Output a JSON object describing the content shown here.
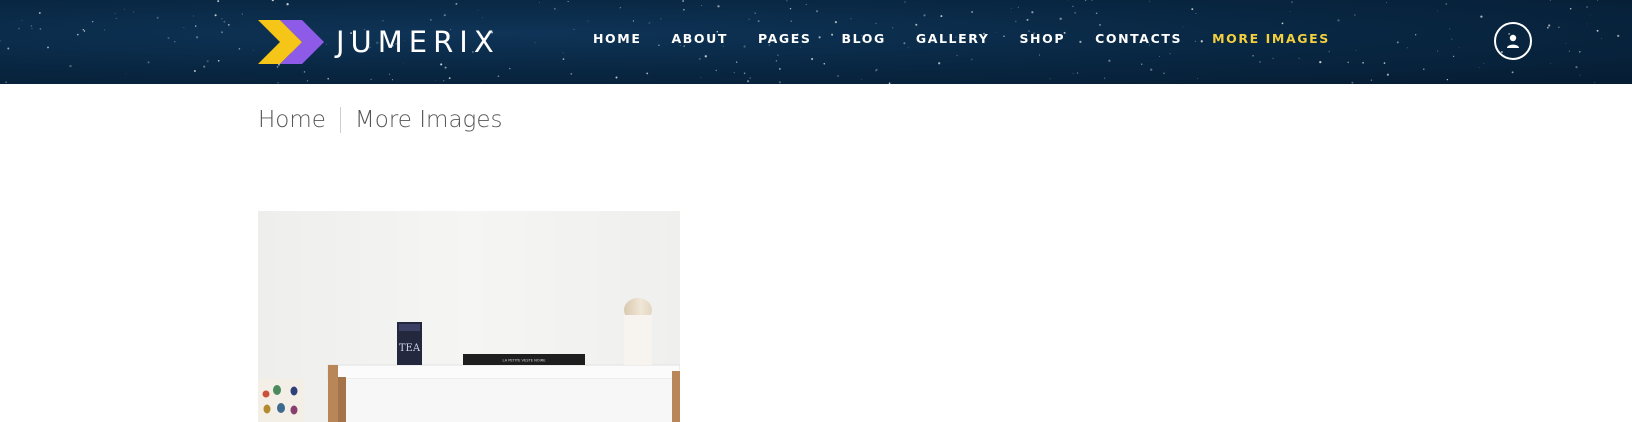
{
  "brand": {
    "name": "JUMERIX",
    "colors": {
      "yellow": "#F5C518",
      "purple": "#8E5BE8",
      "accent": "#F4D03F",
      "header_bg": "#082641"
    }
  },
  "nav": {
    "items": [
      {
        "label": "HOME",
        "active": false
      },
      {
        "label": "ABOUT",
        "active": false
      },
      {
        "label": "PAGES",
        "active": false
      },
      {
        "label": "BLOG",
        "active": false
      },
      {
        "label": "GALLERY",
        "active": false
      },
      {
        "label": "SHOP",
        "active": false
      },
      {
        "label": "CONTACTS",
        "active": false
      },
      {
        "label": "MORE IMAGES",
        "active": true
      }
    ],
    "user_icon": "user-icon"
  },
  "breadcrumb": {
    "home": "Home",
    "current": "More Images"
  },
  "photo": {
    "subject": "white shelf with tea tin, book, vase and beetle print"
  },
  "props": {
    "tin_label": "TEA",
    "book_title": "LA PETITE VESTE NOIRE"
  }
}
